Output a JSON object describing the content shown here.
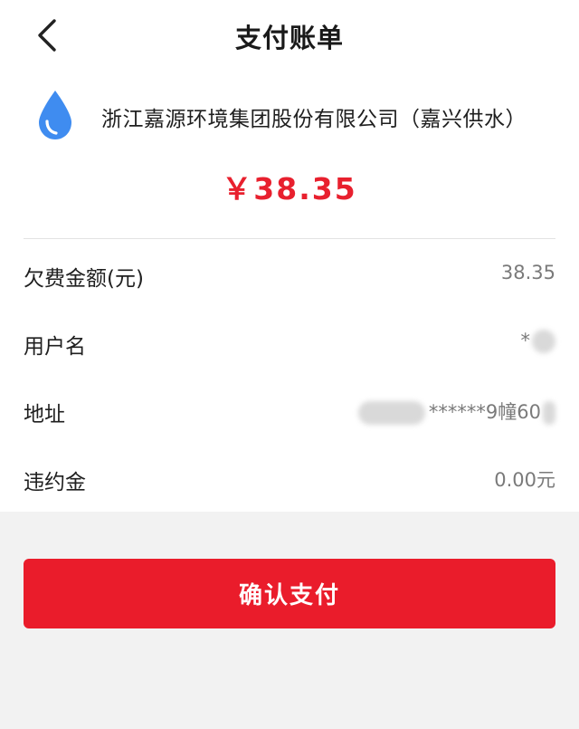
{
  "nav": {
    "title": "支付账单",
    "back_icon": "chevron-left-icon"
  },
  "biller": {
    "icon": "water-drop-icon",
    "name": "浙江嘉源环境集团股份有限公司（嘉兴供水）",
    "icon_color": "#3f8cf0"
  },
  "amount": "￥38.35",
  "details": [
    {
      "label": "欠费金额(元)",
      "value": "38.35"
    },
    {
      "label": "用户名",
      "value": "*"
    },
    {
      "label": "地址",
      "value": "******9幢60"
    },
    {
      "label": "违约金",
      "value": "0.00元"
    }
  ],
  "confirm_button": {
    "label": "确认支付",
    "color": "#ea1c2b"
  },
  "colors": {
    "amount": "#e8202e",
    "background": "#f2f2f2"
  }
}
